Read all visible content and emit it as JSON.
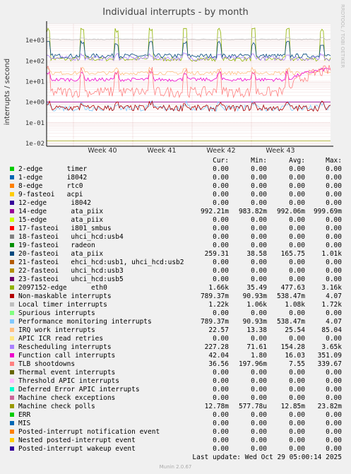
{
  "chart_data": {
    "type": "line",
    "title": "Individual interrupts - by month",
    "ylabel": "interrupts / second",
    "side_label": "RRDTOOL / TOBI OETIKER",
    "y_scale": "log",
    "ylim": [
      0.007,
      6000
    ],
    "y_ticks": [
      "1e+03",
      "1e+02",
      "1e+01",
      "1e+00",
      "1e-01",
      "1e-02"
    ],
    "x_ticks": [
      "Week 40",
      "Week 41",
      "Week 42",
      "Week 43"
    ],
    "grid": true,
    "columns": [
      "Cur:",
      "Min:",
      "Avg:",
      "Max:"
    ],
    "legend": [
      {
        "label": "2-edge      timer",
        "color": "#00cc00",
        "cur": "0.00",
        "min": "0.00",
        "avg": "0.00",
        "max": "0.00"
      },
      {
        "label": "1-edge      i8042",
        "color": "#0066b3",
        "cur": "0.00",
        "min": "0.00",
        "avg": "0.00",
        "max": "0.00"
      },
      {
        "label": "8-edge      rtc0",
        "color": "#ff8000",
        "cur": "0.00",
        "min": "0.00",
        "avg": "0.00",
        "max": "0.00"
      },
      {
        "label": "9-fasteoi   acpi",
        "color": "#ffcc00",
        "cur": "0.00",
        "min": "0.00",
        "avg": "0.00",
        "max": "0.00"
      },
      {
        "label": "12-edge      i8042",
        "color": "#330099",
        "cur": "0.00",
        "min": "0.00",
        "avg": "0.00",
        "max": "0.00"
      },
      {
        "label": "14-edge      ata_piix",
        "color": "#990099",
        "cur": "992.21m",
        "min": "983.82m",
        "avg": "992.06m",
        "max": "999.69m"
      },
      {
        "label": "15-edge      ata_piix",
        "color": "#ccff00",
        "cur": "0.00",
        "min": "0.00",
        "avg": "0.00",
        "max": "0.00"
      },
      {
        "label": "17-fasteoi   i801_smbus",
        "color": "#ff0000",
        "cur": "0.00",
        "min": "0.00",
        "avg": "0.00",
        "max": "0.00"
      },
      {
        "label": "18-fasteoi   uhci_hcd:usb4",
        "color": "#808080",
        "cur": "0.00",
        "min": "0.00",
        "avg": "0.00",
        "max": "0.00"
      },
      {
        "label": "19-fasteoi   radeon",
        "color": "#008f00",
        "cur": "0.00",
        "min": "0.00",
        "avg": "0.00",
        "max": "0.00"
      },
      {
        "label": "20-fasteoi   ata_piix",
        "color": "#00487d",
        "cur": "259.31",
        "min": "38.58",
        "avg": "165.75",
        "max": "1.01k"
      },
      {
        "label": "21-fasteoi   ehci_hcd:usb1, uhci_hcd:usb2",
        "color": "#b35a00",
        "cur": "0.00",
        "min": "0.00",
        "avg": "0.00",
        "max": "0.00"
      },
      {
        "label": "22-fasteoi   uhci_hcd:usb3",
        "color": "#b38f00",
        "cur": "0.00",
        "min": "0.00",
        "avg": "0.00",
        "max": "0.00"
      },
      {
        "label": "23-fasteoi   uhci_hcd:usb5",
        "color": "#6b006b",
        "cur": "0.00",
        "min": "0.00",
        "avg": "0.00",
        "max": "0.00"
      },
      {
        "label": "2097152-edge      eth0",
        "color": "#8fb300",
        "cur": "1.66k",
        "min": "35.49",
        "avg": "477.63",
        "max": "3.16k"
      },
      {
        "label": "Non-maskable interrupts",
        "color": "#b30000",
        "cur": "789.37m",
        "min": "90.93m",
        "avg": "538.47m",
        "max": "4.07"
      },
      {
        "label": "Local timer interrupts",
        "color": "#bebebe",
        "cur": "1.22k",
        "min": "1.06k",
        "avg": "1.08k",
        "max": "1.72k"
      },
      {
        "label": "Spurious interrupts",
        "color": "#80ff80",
        "cur": "0.00",
        "min": "0.00",
        "avg": "0.00",
        "max": "0.00"
      },
      {
        "label": "Performance monitoring interrupts",
        "color": "#80c9ff",
        "cur": "789.37m",
        "min": "90.93m",
        "avg": "538.47m",
        "max": "4.07"
      },
      {
        "label": "IRQ work interrupts",
        "color": "#ffc080",
        "cur": "22.57",
        "min": "13.38",
        "avg": "25.54",
        "max": "85.04"
      },
      {
        "label": "APIC ICR read retries",
        "color": "#ffe680",
        "cur": "0.00",
        "min": "0.00",
        "avg": "0.00",
        "max": "0.00"
      },
      {
        "label": "Rescheduling interrupts",
        "color": "#aa80ff",
        "cur": "227.28",
        "min": "71.61",
        "avg": "154.28",
        "max": "3.65k"
      },
      {
        "label": "Function call interrupts",
        "color": "#ee00cc",
        "cur": "42.04",
        "min": "1.80",
        "avg": "16.03",
        "max": "351.09"
      },
      {
        "label": "TLB shootdowns",
        "color": "#ff8080",
        "cur": "36.56",
        "min": "197.96m",
        "avg": "7.55",
        "max": "339.67"
      },
      {
        "label": "Thermal event interrupts",
        "color": "#666600",
        "cur": "0.00",
        "min": "0.00",
        "avg": "0.00",
        "max": "0.00"
      },
      {
        "label": "Threshold APIC interrupts",
        "color": "#ffbfff",
        "cur": "0.00",
        "min": "0.00",
        "avg": "0.00",
        "max": "0.00"
      },
      {
        "label": "Deferred Error APIC interrupts",
        "color": "#00ffcc",
        "cur": "0.00",
        "min": "0.00",
        "avg": "0.00",
        "max": "0.00"
      },
      {
        "label": "Machine check exceptions",
        "color": "#cc6699",
        "cur": "0.00",
        "min": "0.00",
        "avg": "0.00",
        "max": "0.00"
      },
      {
        "label": "Machine check polls",
        "color": "#999900",
        "cur": "12.78m",
        "min": "577.78u",
        "avg": "12.85m",
        "max": "23.82m"
      },
      {
        "label": "ERR",
        "color": "#00cc00",
        "cur": "0.00",
        "min": "0.00",
        "avg": "0.00",
        "max": "0.00"
      },
      {
        "label": "MIS",
        "color": "#0066b3",
        "cur": "0.00",
        "min": "0.00",
        "avg": "0.00",
        "max": "0.00"
      },
      {
        "label": "Posted-interrupt notification event",
        "color": "#ff8000",
        "cur": "0.00",
        "min": "0.00",
        "avg": "0.00",
        "max": "0.00"
      },
      {
        "label": "Nested posted-interrupt event",
        "color": "#ffcc00",
        "cur": "0.00",
        "min": "0.00",
        "avg": "0.00",
        "max": "0.00"
      },
      {
        "label": "Posted-interrupt wakeup event",
        "color": "#330099",
        "cur": "0.00",
        "min": "0.00",
        "avg": "0.00",
        "max": "0.00"
      }
    ],
    "series_levels": [
      {
        "name": "2097152-edge      eth0",
        "color": "#8fb300",
        "base": 120,
        "spike": 3000,
        "period": 24,
        "noise": 0.25
      },
      {
        "name": "20-fasteoi   ata_piix",
        "color": "#00487d",
        "base": 170,
        "spike": 700,
        "period": 24,
        "noise": 0.25
      },
      {
        "name": "Local timer interrupts",
        "color": "#bebebe",
        "base": 1080,
        "spike": 1300,
        "period": 24,
        "noise": 0.05
      },
      {
        "name": "Rescheduling interrupts",
        "color": "#aa80ff",
        "base": 130,
        "spike": 200,
        "period": 24,
        "noise": 0.25
      },
      {
        "name": "IRQ work interrupts",
        "color": "#ffc080",
        "base": 25,
        "spike": 40,
        "period": 24,
        "noise": 0.2
      },
      {
        "name": "Function call interrupts",
        "color": "#ee00cc",
        "base": 12,
        "spike": 25,
        "period": 24,
        "noise": 0.2,
        "rise_to": 42
      },
      {
        "name": "TLB shootdowns",
        "color": "#ff8080",
        "base": 3,
        "spike": 30,
        "period": 24,
        "noise": 0.6,
        "rise_to": 36
      },
      {
        "name": "14-edge      ata_piix",
        "color": "#990099",
        "base": 0.99,
        "spike": 0.99,
        "period": 24,
        "noise": 0
      },
      {
        "name": "Performance monitoring interrupts",
        "color": "#80c9ff",
        "base": 0.5,
        "spike": 0.8,
        "period": 24,
        "noise": 0.35
      },
      {
        "name": "Non-maskable interrupts",
        "color": "#b30000",
        "base": 0.5,
        "spike": 0.8,
        "period": 24,
        "noise": 0.35
      },
      {
        "name": "Machine check polls",
        "color": "#999900",
        "base": 0.0128,
        "spike": 0.0128,
        "period": 24,
        "noise": 0
      }
    ]
  },
  "last_update": "Last update: Wed Oct 29 05:00:14 2025",
  "footer": "Munin 2.0.67"
}
